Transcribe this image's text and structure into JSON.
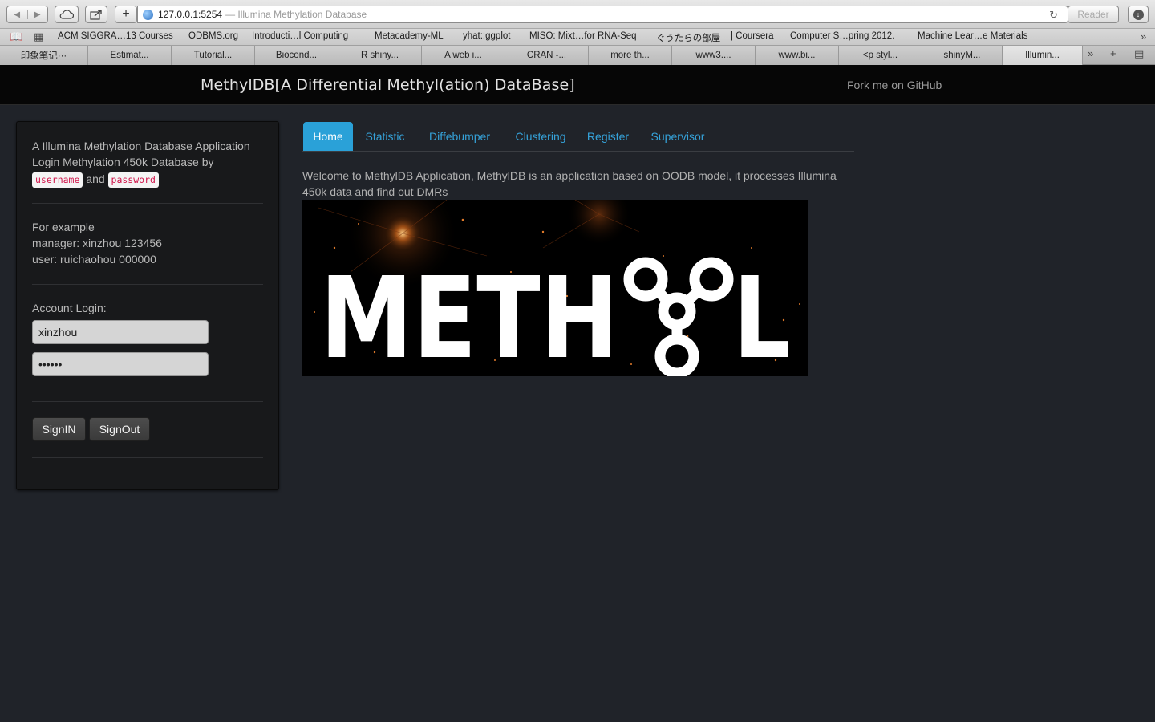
{
  "browser": {
    "url": "127.0.0.1:5254",
    "page_title": "— Illumina Methylation Database",
    "reader_label": "Reader",
    "bookmarks": [
      "ACM SIGGRA…13 Courses",
      "ODBMS.org",
      "Introducti…l Computing",
      "Metacademy-ML",
      "yhat::ggplot",
      "MISO: Mixt…for RNA-Seq",
      "ぐうたらの部屋",
      "| Coursera",
      "Computer S…pring 2012.",
      "Machine Lear…e Materials"
    ],
    "tabs": [
      "印象笔记···",
      "Estimat...",
      "Tutorial...",
      "Biocond...",
      "R shiny...",
      "A web i...",
      "CRAN -...",
      "more th...",
      "www3....",
      "www.bi...",
      "<p styl...",
      "shinyM...",
      "Illumin..."
    ]
  },
  "header": {
    "brand": "MethylDB[A Differential Methyl(ation) DataBase]",
    "fork_link": "Fork me on GitHub"
  },
  "sidebar": {
    "intro_line1": "A Illumina Methylation Database Application",
    "intro_line2": "Login Methylation 450k Database by",
    "code_username": "username",
    "and_word": "and",
    "code_password": "password",
    "example_title": "For example",
    "example_manager": "manager: xinzhou 123456",
    "example_user": "user: ruichaohou 000000",
    "login_label": "Account Login:",
    "username_value": "xinzhou",
    "password_value": "123456",
    "signin_label": "SignIN",
    "signout_label": "SignOut"
  },
  "main": {
    "tabs": [
      "Home",
      "Statistic",
      "Diffebumper",
      "Clustering",
      "Register",
      "Supervisor"
    ],
    "active_tab": "Home",
    "welcome": "Welcome to MethylDB Application, MethylDB is an application based on OODB model, it processes Illumina 450k data and find out DMRs",
    "logo_text": "METHYL"
  },
  "colors": {
    "accent": "#2aa1d8",
    "page_bg": "#202329",
    "navbar_bg": "#060606",
    "code_text": "#d0144a"
  }
}
